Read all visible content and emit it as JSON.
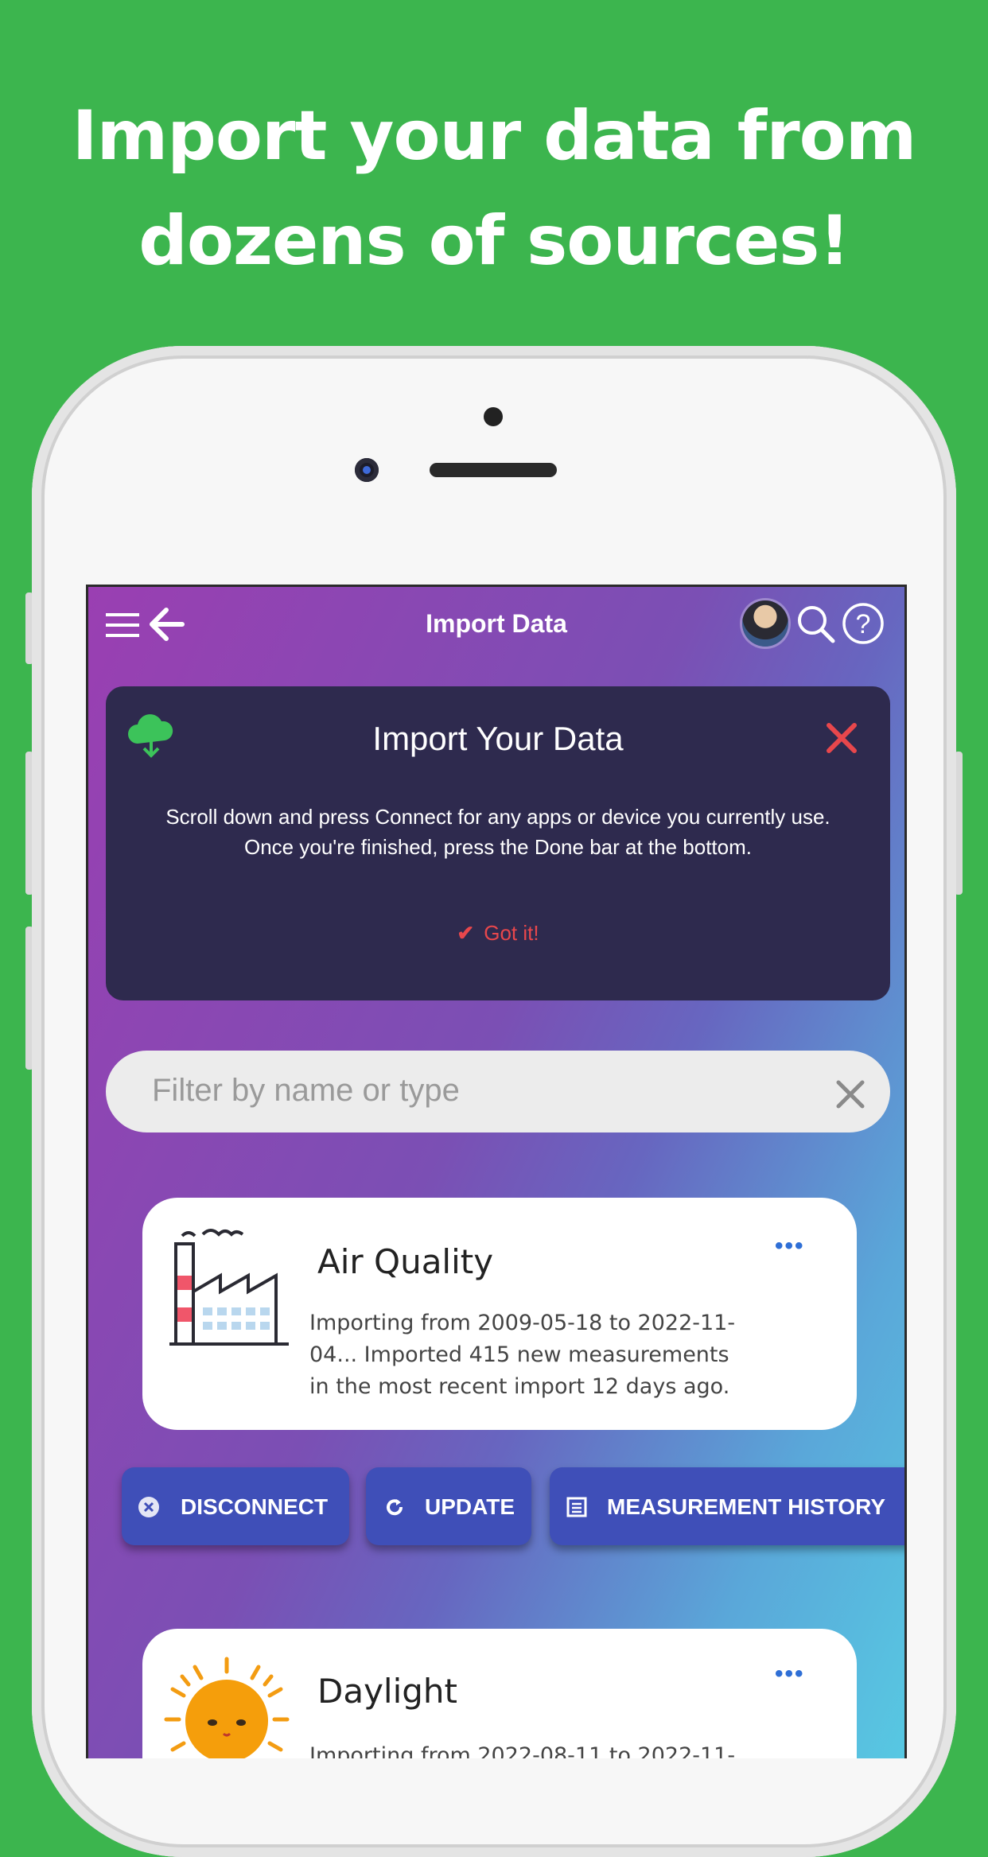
{
  "headline": {
    "line1": "Import your data from",
    "line2": "dozens of sources!"
  },
  "topbar": {
    "title": "Import Data",
    "icons": [
      "menu-icon",
      "back-arrow-icon",
      "avatar",
      "search-icon",
      "help-icon"
    ]
  },
  "info_card": {
    "title": "Import Your Data",
    "line1": "Scroll down and press Connect for any apps or device you currently use.",
    "line2": "Once you're finished, press the Done bar at the bottom.",
    "got_it": "Got it!",
    "icons": [
      "cloud-download-icon",
      "close-icon",
      "check-icon"
    ]
  },
  "filter": {
    "placeholder": "Filter by name or type"
  },
  "connectors": [
    {
      "name": "Air Quality",
      "description": "Importing from 2009-05-18 to 2022-11-04... Imported 415 new measurements in the most recent import 12 days ago.",
      "icon": "factory-icon",
      "menu": "•••"
    },
    {
      "name": "Daylight",
      "description": "Importing from 2022-08-11 to 2022-11-",
      "icon": "sun-icon",
      "menu": "•••"
    }
  ],
  "actions": {
    "disconnect": "DISCONNECT",
    "update": "UPDATE",
    "history": "MEASUREMENT HISTORY"
  },
  "colors": {
    "background": "#3cb54e",
    "card_dark": "#2e2a4e",
    "accent_red": "#e8474c",
    "button_blue": "#3f4fb8",
    "link_blue": "#2f6fd6"
  }
}
